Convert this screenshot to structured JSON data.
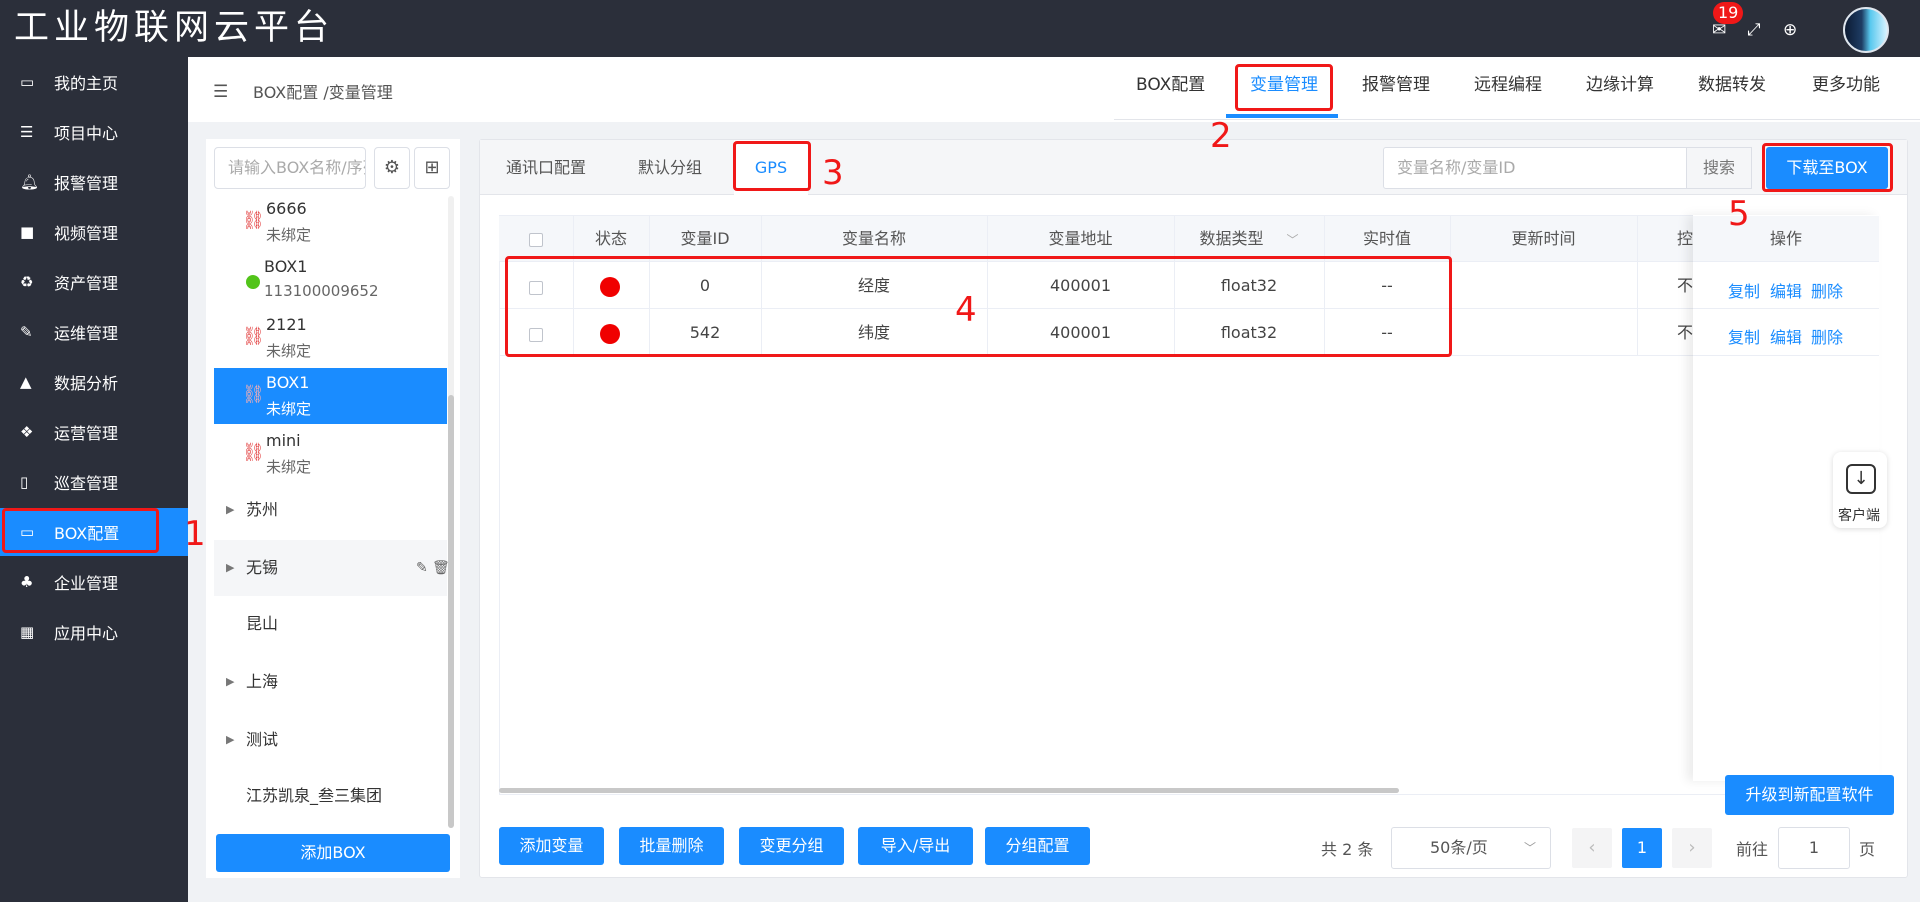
{
  "app": {
    "title": "工业物联网云平台",
    "notification_count": "19"
  },
  "sidebar": {
    "items": [
      {
        "label": "我的主页",
        "icon": "laptop-icon"
      },
      {
        "label": "项目中心",
        "icon": "list-icon"
      },
      {
        "label": "报警管理",
        "icon": "bell-icon"
      },
      {
        "label": "视频管理",
        "icon": "video-icon"
      },
      {
        "label": "资产管理",
        "icon": "recycle-icon"
      },
      {
        "label": "运维管理",
        "icon": "wrench-icon"
      },
      {
        "label": "数据分析",
        "icon": "chart-icon"
      },
      {
        "label": "运营管理",
        "icon": "cubes-icon"
      },
      {
        "label": "巡查管理",
        "icon": "file-icon"
      },
      {
        "label": "BOX配置",
        "icon": "monitor-icon"
      },
      {
        "label": "企业管理",
        "icon": "sitemap-icon"
      },
      {
        "label": "应用中心",
        "icon": "grid-icon"
      }
    ],
    "active": "BOX配置"
  },
  "breadcrumb": "BOX配置 /变量管理",
  "top_tabs": [
    "BOX配置",
    "变量管理",
    "报警管理",
    "远程编程",
    "边缘计算",
    "数据转发",
    "更多功能"
  ],
  "active_top_tab": "变量管理",
  "left_panel": {
    "search_placeholder": "请输入BOX名称/序列号",
    "devices": [
      {
        "title": "6666",
        "sub": "未绑定"
      },
      {
        "title": "BOX1",
        "sub": "113100009652"
      },
      {
        "title": "2121",
        "sub": "未绑定"
      },
      {
        "title": "BOX1",
        "sub": "未绑定"
      },
      {
        "title": "mini",
        "sub": "未绑定"
      }
    ],
    "groups": [
      "苏州",
      "无锡",
      "昆山",
      "上海",
      "测试",
      "江苏凯泉_叁三集团"
    ],
    "add_button": "添加BOX"
  },
  "sub_tabs": [
    "通讯口配置",
    "默认分组",
    "GPS"
  ],
  "active_sub_tab": "GPS",
  "var_search_placeholder": "变量名称/变量ID",
  "search_button": "搜索",
  "download_button": "下载至BOX",
  "table": {
    "headers": [
      "状态",
      "变量ID",
      "变量名称",
      "变量地址",
      "数据类型",
      "实时值",
      "更新时间",
      "控",
      "操作"
    ],
    "rows": [
      {
        "status": "red",
        "id": "0",
        "name": "经度",
        "address": "400001",
        "type": "float32",
        "value": "--",
        "updated": "",
        "ctrl": "不可"
      },
      {
        "status": "red",
        "id": "542",
        "name": "纬度",
        "address": "400001",
        "type": "float32",
        "value": "--",
        "updated": "",
        "ctrl": "不可"
      }
    ],
    "actions": [
      "复制",
      "编辑",
      "删除"
    ]
  },
  "client_label": "客户端",
  "upgrade_button": "升级到新配置软件",
  "bottom_buttons": [
    "添加变量",
    "批量删除",
    "变更分组",
    "导入/导出",
    "分组配置"
  ],
  "pagination": {
    "total": "共 2 条",
    "page_size": "50条/页",
    "current": "1",
    "goto_label": "前往",
    "goto_value": "1",
    "suffix": "页"
  },
  "annotations": [
    "1",
    "2",
    "3",
    "4",
    "5"
  ],
  "colors": {
    "primary": "#1a8cff",
    "sidebar_bg": "#2b2f3a",
    "annotation_red": "#f01818",
    "status_red": "#f00000"
  }
}
